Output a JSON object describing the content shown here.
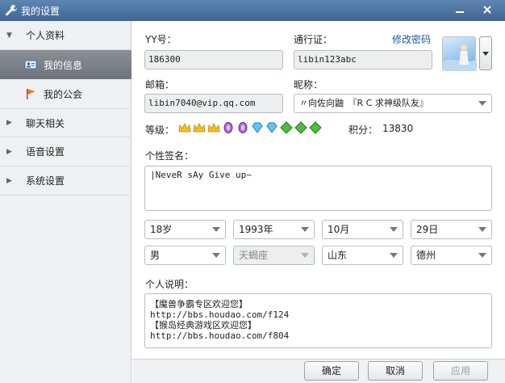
{
  "window": {
    "title": "我的设置"
  },
  "sidebar": {
    "groups": [
      {
        "label": "个人资料",
        "expanded": true
      },
      {
        "label": "聊天相关",
        "expanded": false
      },
      {
        "label": "语音设置",
        "expanded": false
      },
      {
        "label": "系统设置",
        "expanded": false
      }
    ],
    "subitems": [
      {
        "label": "我的信息",
        "active": true
      },
      {
        "label": "我的公会",
        "active": false
      }
    ]
  },
  "profile": {
    "yy_label": "YY号：",
    "yy_value": "186300",
    "passport_label": "通行证：",
    "passport_value": "libin123abc",
    "change_password": "修改密码",
    "email_label": "邮箱：",
    "email_value": "libin7040@vip.qq.com",
    "nickname_label": "昵称：",
    "nickname_value": "〃向佐向鼬　『R C 求神级队友』",
    "level_label": "等级：",
    "points_label": "积分：",
    "points_value": "13830",
    "signature_label": "个性签名：",
    "signature_value": "|NeveR sAy Give up~",
    "age": "18岁",
    "birth_year": "1993年",
    "birth_month": "10月",
    "birth_day": "29日",
    "gender": "男",
    "zodiac": "天蝎座",
    "province": "山东",
    "city": "德州",
    "description_label": "个人说明：",
    "description_lines": [
      "【魔兽争霸专区欢迎您】",
      "http://bbs.houdao.com/f124",
      "【猴岛经典游戏区欢迎您】",
      "http://bbs.houdao.com/f804"
    ]
  },
  "buttons": {
    "ok": "确定",
    "cancel": "取消",
    "apply": "应用"
  },
  "colors": {
    "titlebar": "#4a72a3",
    "link": "#1f58a6",
    "active_nav": "#7a7f86"
  }
}
